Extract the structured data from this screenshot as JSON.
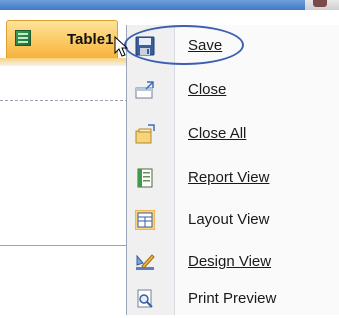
{
  "tab": {
    "title": "Table1"
  },
  "menu": {
    "items": [
      {
        "label": "Save",
        "icon": "save-icon"
      },
      {
        "label": "Close",
        "icon": "close-window-icon"
      },
      {
        "label": "Close All",
        "icon": "close-all-icon"
      },
      {
        "label": "Report View",
        "icon": "report-view-icon"
      },
      {
        "label": "Layout View",
        "icon": "layout-view-icon"
      },
      {
        "label": "Design View",
        "icon": "design-view-icon"
      },
      {
        "label": "Print Preview",
        "icon": "print-preview-icon"
      }
    ]
  },
  "colors": {
    "tab_active": "#fbc75d",
    "highlight_ring": "#3d5fb0",
    "ribbon": "#3f78c8"
  }
}
